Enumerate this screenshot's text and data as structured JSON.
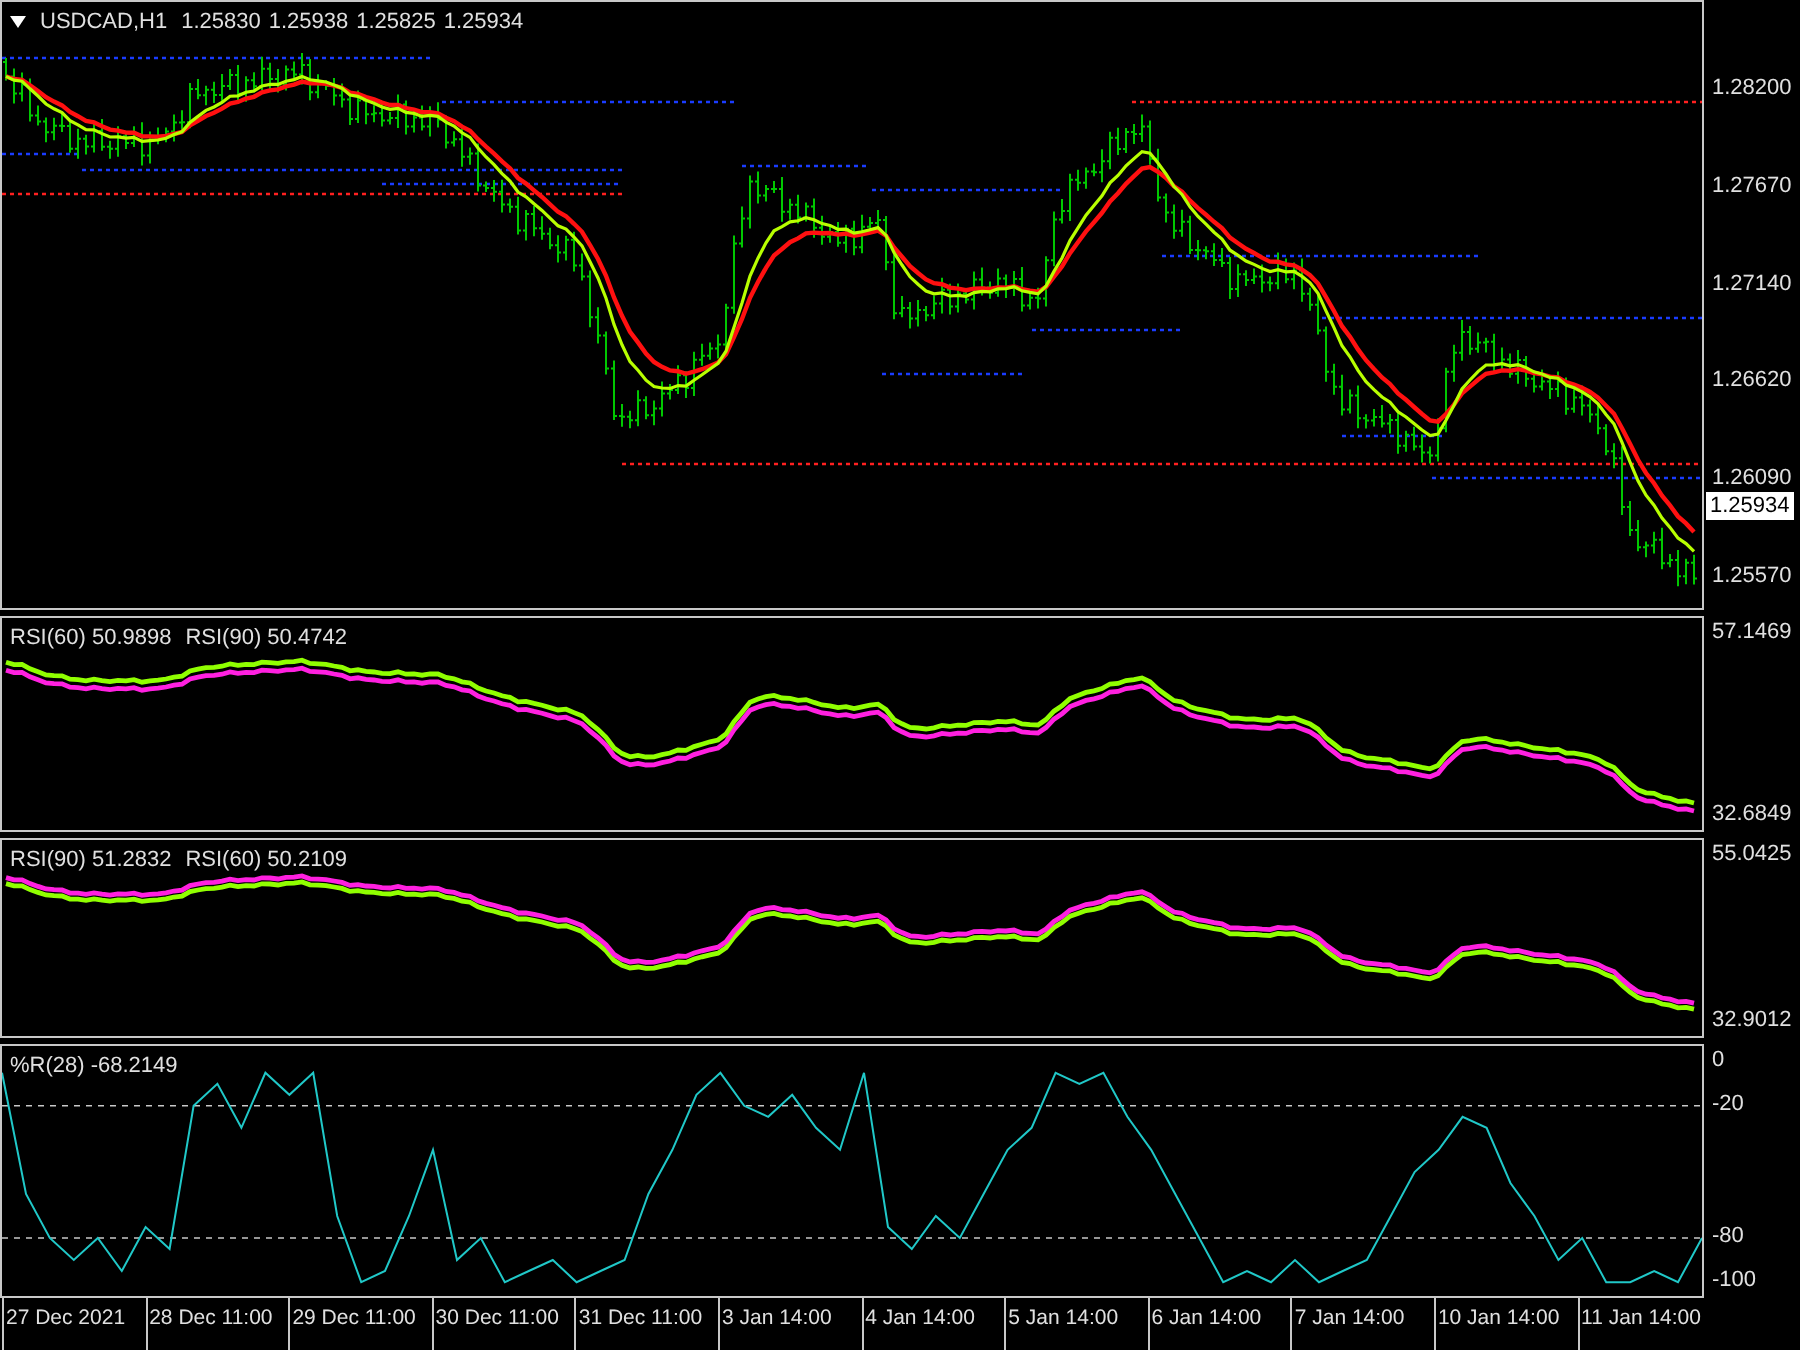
{
  "header": {
    "symbol": "USDCAD,H1",
    "ohlc": [
      "1.25830",
      "1.25938",
      "1.25825",
      "1.25934"
    ]
  },
  "panels": [
    {
      "kind": "price",
      "axis_labels": [
        "1.28200",
        "1.27670",
        "1.27140",
        "1.26620",
        "1.26090",
        "1.25570"
      ],
      "current_price": "1.25934"
    },
    {
      "kind": "rsi",
      "readings": [
        "RSI(60) 50.9898",
        "RSI(90) 50.4742"
      ],
      "axis_labels": [
        "57.1469",
        "32.6849"
      ]
    },
    {
      "kind": "rsi",
      "readings": [
        "RSI(90) 51.2832",
        "RSI(60) 50.2109"
      ],
      "axis_labels": [
        "55.0425",
        "32.9012"
      ]
    },
    {
      "kind": "wpr",
      "readings": [
        "%R(28) -68.2149"
      ],
      "chart_data": {
        "type": "line",
        "ylim": [
          -106.3,
          7.14
        ],
        "yticks": [
          0,
          -20,
          -80,
          -100
        ],
        "series": [
          {
            "color": "#20c8c8",
            "values": [
              -5,
              -60,
              -80,
              -90,
              -80,
              -95,
              -75,
              -85,
              -20,
              -10,
              -30,
              -5,
              -15,
              -5,
              -70,
              -100,
              -95,
              -70,
              -40,
              -90,
              -80,
              -100,
              -95,
              -90,
              -100,
              -95,
              -90,
              -60,
              -40,
              -15,
              -5,
              -20,
              -25,
              -15,
              -30,
              -40,
              -5,
              -75,
              -85,
              -70,
              -80,
              -60,
              -40,
              -30,
              -5,
              -10,
              -5,
              -25,
              -40,
              -60,
              -80,
              -100,
              -95,
              -100,
              -90,
              -100,
              -95,
              -90,
              -70,
              -50,
              -40,
              -25,
              -30,
              -55,
              -70,
              -90,
              -80,
              -100,
              -100,
              -95,
              -100,
              -80
            ]
          }
        ]
      }
    }
  ],
  "time_axis": [
    "27 Dec 2021",
    "28 Dec 11:00",
    "29 Dec 11:00",
    "30 Dec 11:00",
    "31 Dec 11:00",
    "3 Jan 14:00",
    "4 Jan 14:00",
    "5 Jan 14:00",
    "6 Jan 14:00",
    "7 Jan 14:00",
    "10 Jan 14:00",
    "11 Jan 14:00"
  ]
}
